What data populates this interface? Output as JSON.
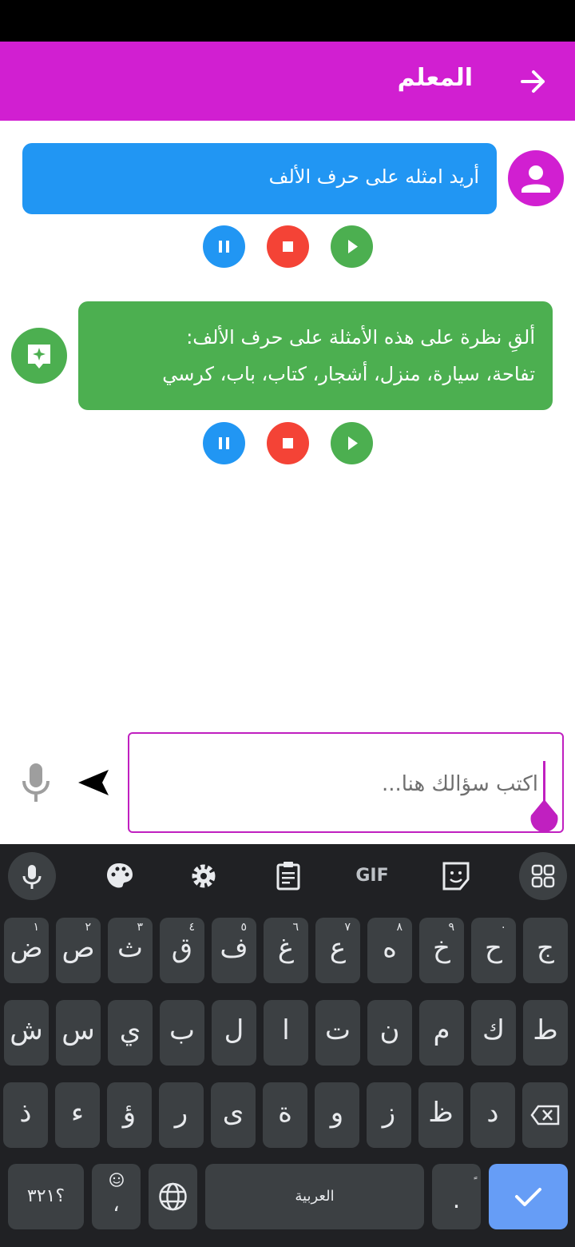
{
  "app": {
    "title": "المعلم"
  },
  "messages": [
    {
      "role": "user",
      "text": "أريد امثله على حرف الألف"
    },
    {
      "role": "assistant",
      "lines": [
        "ألقِ نظرة على هذه الأمثلة على حرف الألف:",
        "تفاحة، سيارة، منزل، أشجار، كتاب، باب، كرسي"
      ]
    }
  ],
  "input": {
    "placeholder": "اكتب سؤالك هنا..."
  },
  "keyboard": {
    "toolbar": [
      "mic-icon",
      "palette-icon",
      "gear-icon",
      "clipboard-icon",
      "GIF",
      "sticker-icon",
      "grid-icon"
    ],
    "gif_label": "GIF",
    "row1": [
      {
        "k": "ج",
        "h": ""
      },
      {
        "k": "ح",
        "h": "٠"
      },
      {
        "k": "خ",
        "h": "٩"
      },
      {
        "k": "ه",
        "h": "٨"
      },
      {
        "k": "ع",
        "h": "٧"
      },
      {
        "k": "غ",
        "h": "٦"
      },
      {
        "k": "ف",
        "h": "٥"
      },
      {
        "k": "ق",
        "h": "٤"
      },
      {
        "k": "ث",
        "h": "٣"
      },
      {
        "k": "ص",
        "h": "٢"
      },
      {
        "k": "ض",
        "h": "١"
      }
    ],
    "row2": [
      "ط",
      "ك",
      "م",
      "ن",
      "ت",
      "ا",
      "ل",
      "ب",
      "ي",
      "س",
      "ش"
    ],
    "row3": [
      "د",
      "ظ",
      "ز",
      "و",
      "ة",
      "ى",
      "ر",
      "ؤ",
      "ء",
      "ذ"
    ],
    "numbers_key": "؟٣٢١",
    "comma_key": "،",
    "space_label": "العربية",
    "period_key": ".",
    "colors": {
      "bg": "#202124",
      "key": "#3c4043",
      "action": "#669df6"
    }
  },
  "colors": {
    "appbar": "#d11fd1",
    "user_bubble": "#2196f3",
    "bot_bubble": "#4caf50",
    "pause": "#2196f3",
    "stop": "#f44336",
    "play": "#4caf50"
  }
}
